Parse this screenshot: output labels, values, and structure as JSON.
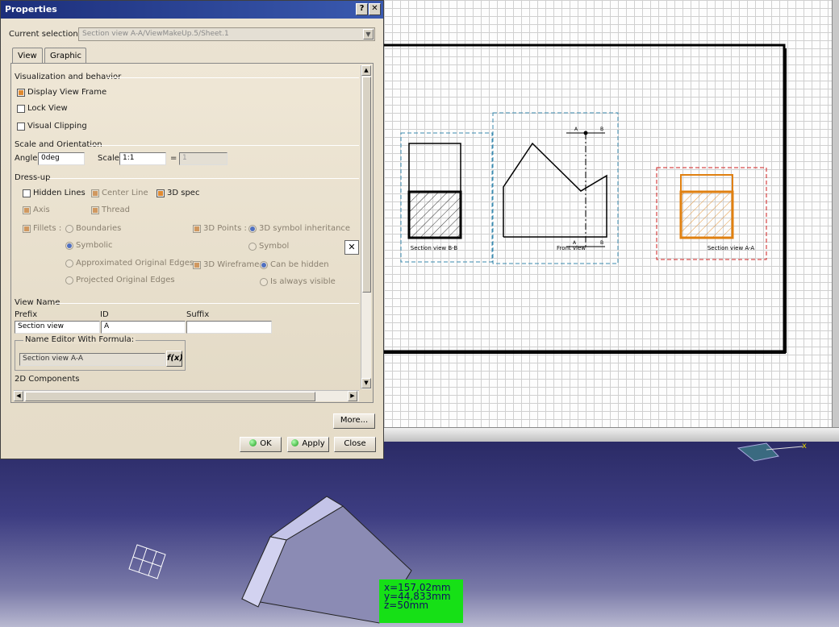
{
  "dialog": {
    "title": "Properties",
    "help_btn": "?",
    "close_btn": "✕",
    "current_selection_label": "Current selection :",
    "current_selection_value": "Section view A-A/ViewMakeUp.5/Sheet.1",
    "tabs": [
      "View",
      "Graphic"
    ],
    "visualization": {
      "header": "Visualization and behavior",
      "display_view_frame": "Display View Frame",
      "lock_view": "Lock View",
      "visual_clipping": "Visual Clipping"
    },
    "scale": {
      "header": "Scale and Orientation",
      "angle_label": "Angle:",
      "angle_value": "0deg",
      "scale_label": "Scale:",
      "scale_value": "1:1",
      "equals": "=",
      "result_value": "1"
    },
    "dressup": {
      "header": "Dress-up",
      "hidden_lines": "Hidden Lines",
      "center_line": "Center Line",
      "spec_3d": "3D spec",
      "axis": "Axis",
      "thread": "Thread",
      "fillets": "Fillets :",
      "boundaries": "Boundaries",
      "symbolic": "Symbolic",
      "approximated": "Approximated Original Edges",
      "projected": "Projected Original Edges",
      "points_3d": "3D Points :",
      "symbol_inheritance": "3D symbol inheritance",
      "symbol": "Symbol",
      "wireframe_3d": "3D Wireframe",
      "can_be_hidden": "Can be hidden",
      "always_visible": "Is always visible"
    },
    "view_name": {
      "header": "View Name",
      "prefix_label": "Prefix",
      "id_label": "ID",
      "suffix_label": "Suffix",
      "prefix_value": "Section view",
      "id_value": "A",
      "suffix_value": "",
      "formula_header": "Name Editor With Formula:",
      "formula_value": "Section view A-A",
      "fx": "f(x)"
    },
    "components_2d": "2D Components",
    "more_btn": "More...",
    "ok_btn": "OK",
    "apply_btn": "Apply",
    "close_button": "Close"
  },
  "drawing": {
    "section_bb_label": "Section view B-B",
    "front_view_label": "Front view",
    "section_aa_label": "Section view A-A",
    "cut_label_a": "A",
    "cut_label_b": "B"
  },
  "viewport": {
    "coord_x": "x=157,02mm",
    "coord_y": "y=44,833mm",
    "coord_z": "z=50mm"
  },
  "colors": {
    "title_bar": "#1c2e7a",
    "selection_orange": "#e08010",
    "coord_box": "#16e016",
    "frame_blue": "#3a8ab0",
    "frame_red": "#d02020"
  }
}
